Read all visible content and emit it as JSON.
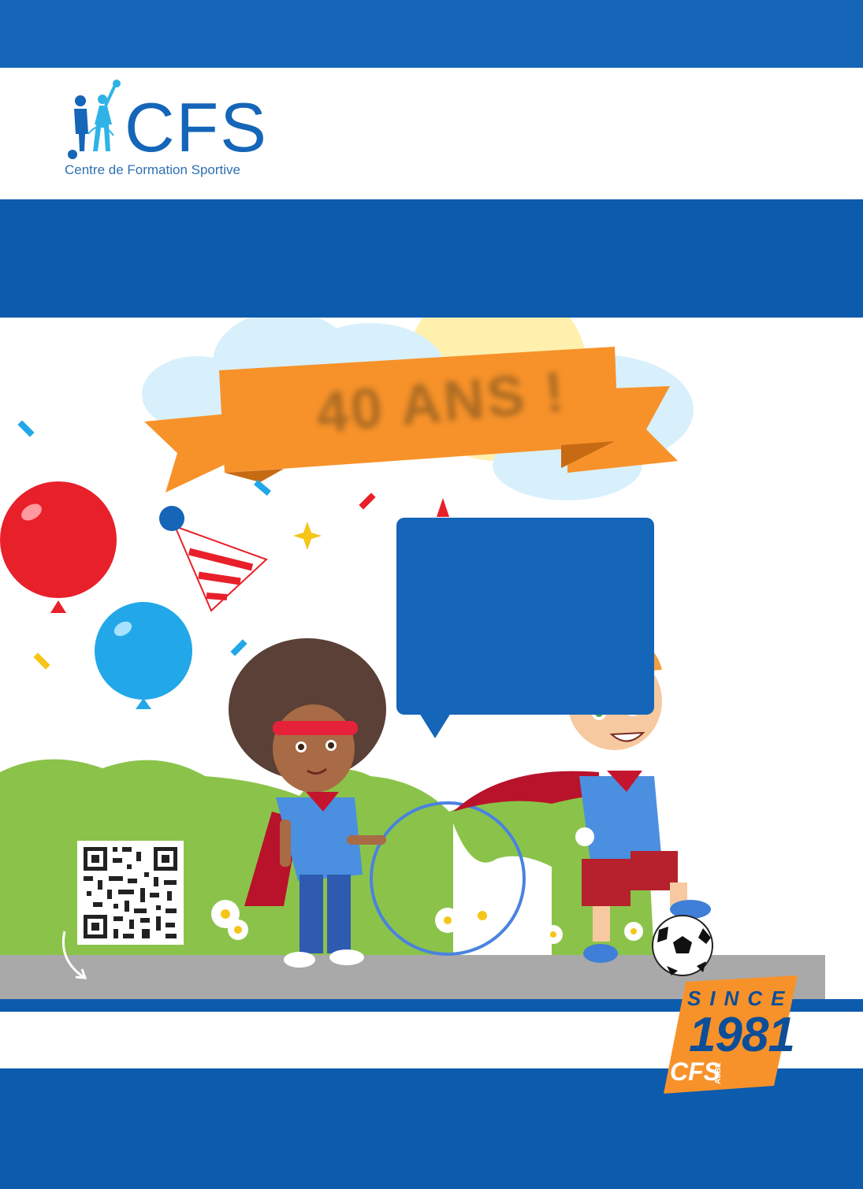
{
  "header": {
    "logo_text": "CFS",
    "logo_tagline": "Centre de Formation Sportive"
  },
  "banner": {
    "text": "40 ANS !"
  },
  "badge": {
    "since_label": "SINCE",
    "year": "1981",
    "org": "CFS",
    "suffix": "ASBL"
  },
  "colors": {
    "brand_blue": "#1565b8",
    "dark_blue": "#0d5bad",
    "banner_orange": "#f7922a",
    "grass_green": "#8bc34a"
  },
  "icons": [
    "qr-code-icon",
    "curved-arrow-icon",
    "balloon-icon",
    "party-hat-icon",
    "soccer-ball-icon",
    "sun-icon",
    "cloud-icon",
    "daisy-icon"
  ]
}
